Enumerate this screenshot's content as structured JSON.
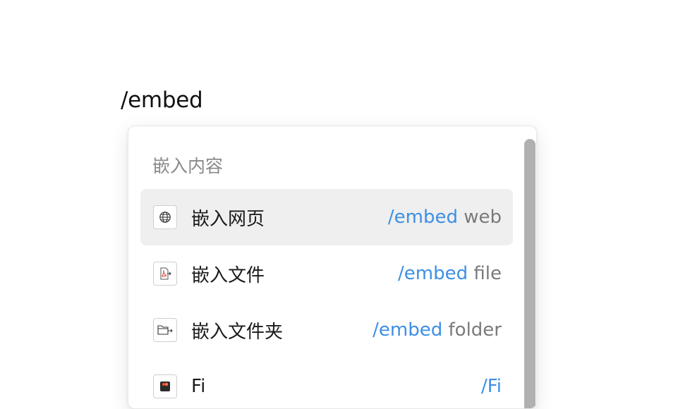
{
  "editor": {
    "typed_text": "/embed"
  },
  "popup": {
    "section_title": "嵌入内容",
    "items": [
      {
        "label": "嵌入网页",
        "command": "/embed",
        "arg": " web",
        "icon": "globe-icon",
        "selected": true
      },
      {
        "label": "嵌入文件",
        "command": "/embed",
        "arg": " file",
        "icon": "pdf-file-icon",
        "selected": false
      },
      {
        "label": "嵌入文件夹",
        "command": "/embed",
        "arg": " folder",
        "icon": "folder-icon",
        "selected": false
      },
      {
        "label": "Fi",
        "command": "/Fi",
        "arg": "",
        "icon": "figma-icon",
        "selected": false
      }
    ]
  },
  "colors": {
    "accent": "#3d8fe6",
    "selected_bg": "#efefef"
  }
}
